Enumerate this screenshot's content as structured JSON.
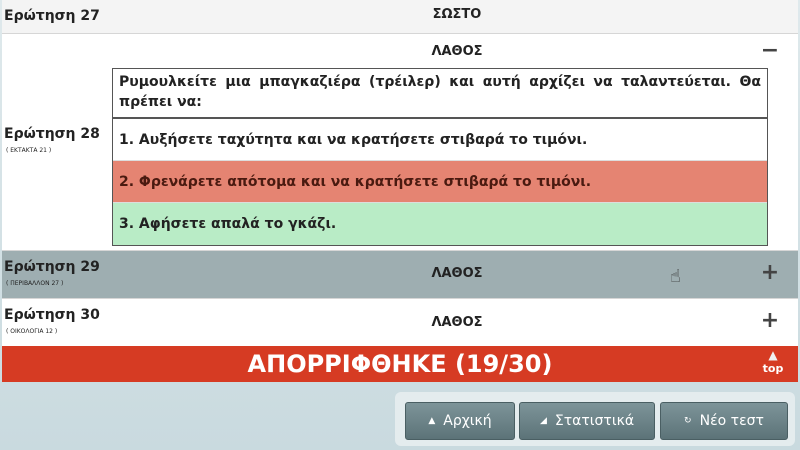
{
  "questions": [
    {
      "label": "Ερώτηση 27",
      "sub": "",
      "result": "ΣΩΣΤΟ",
      "toggle": ""
    },
    {
      "label": "Ερώτηση 28",
      "sub": "( ΕΚΤΑΚΤΑ 21 )",
      "result": "ΛΑΘΟΣ",
      "toggle": "−",
      "question_text": "Ρυμουλκείτε μια μπαγκαζιέρα (τρέιλερ) και αυτή αρχίζει να ταλαντεύεται. Θα πρέπει να:",
      "answers": [
        {
          "text": "1. Αυξήσετε ταχύτητα και να κρατήσετε στιβαρά το τιμόνι.",
          "state": "neutral"
        },
        {
          "text": "2. Φρενάρετε απότομα και να κρατήσετε στιβαρά το τιμόνι.",
          "state": "wrong"
        },
        {
          "text": "3. Αφήσετε απαλά το γκάζι.",
          "state": "correct"
        }
      ]
    },
    {
      "label": "Ερώτηση 29",
      "sub": "( ΠΕΡΙΒΑΛΛΟΝ 27 )",
      "result": "ΛΑΘΟΣ",
      "toggle": "+"
    },
    {
      "label": "Ερώτηση 30",
      "sub": "( ΟΙΚΟΛΟΓΙΑ 12 )",
      "result": "ΛΑΘΟΣ",
      "toggle": "+"
    }
  ],
  "banner": {
    "text": "ΑΠΟΡΡΙΦΘΗΚΕ (19/30)",
    "top_label": "top",
    "color": "#d63b23"
  },
  "buttons": {
    "home": "Αρχική",
    "stats": "Στατιστικά",
    "new_test": "Νέο τεστ"
  },
  "colors": {
    "wrong_answer": "#e58472",
    "correct_answer": "#b9ecc6",
    "highlight_row": "#9eaeb1"
  },
  "icons": {
    "collapse": "minus-icon",
    "expand": "plus-icon",
    "home": "home-icon",
    "stats": "stats-icon",
    "new_test": "refresh-icon"
  }
}
